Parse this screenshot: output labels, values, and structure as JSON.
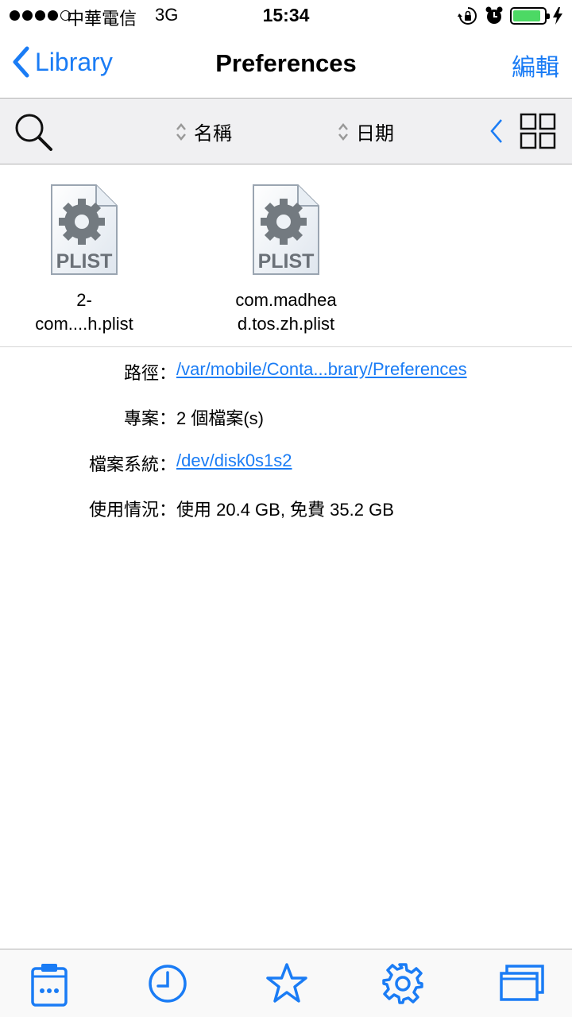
{
  "status_bar": {
    "carrier": "中華電信",
    "network": "3G",
    "time": "15:34",
    "battery_level": 0.9,
    "battery_color": "#4cd964"
  },
  "nav": {
    "back_label": "Library",
    "title": "Preferences",
    "edit_label": "編輯"
  },
  "toolbar": {
    "sort_name_label": "名稱",
    "sort_date_label": "日期"
  },
  "files": [
    {
      "name_line1": "2-",
      "name_line2": "com....h.plist",
      "icon_label": "PLIST"
    },
    {
      "name_line1": "com.madhea",
      "name_line2": "d.tos.zh.plist",
      "icon_label": "PLIST"
    }
  ],
  "info": {
    "path_label": "路徑：",
    "path_value": "/var/mobile/Conta...brary/Preferences",
    "items_label": "專案：",
    "items_value": "2 個檔案(s)",
    "fs_label": "檔案系統：",
    "fs_value": "/dev/disk0s1s2",
    "usage_label": "使用情況：",
    "usage_value": "使用 20.4 GB, 免費 35.2 GB"
  },
  "tab_bar": {
    "icons": [
      "clipboard-icon",
      "clock-icon",
      "star-icon",
      "gear-icon",
      "windows-icon"
    ]
  },
  "colors": {
    "accent": "#1a7cf5",
    "toolbar_bg": "#f0f0f2"
  }
}
